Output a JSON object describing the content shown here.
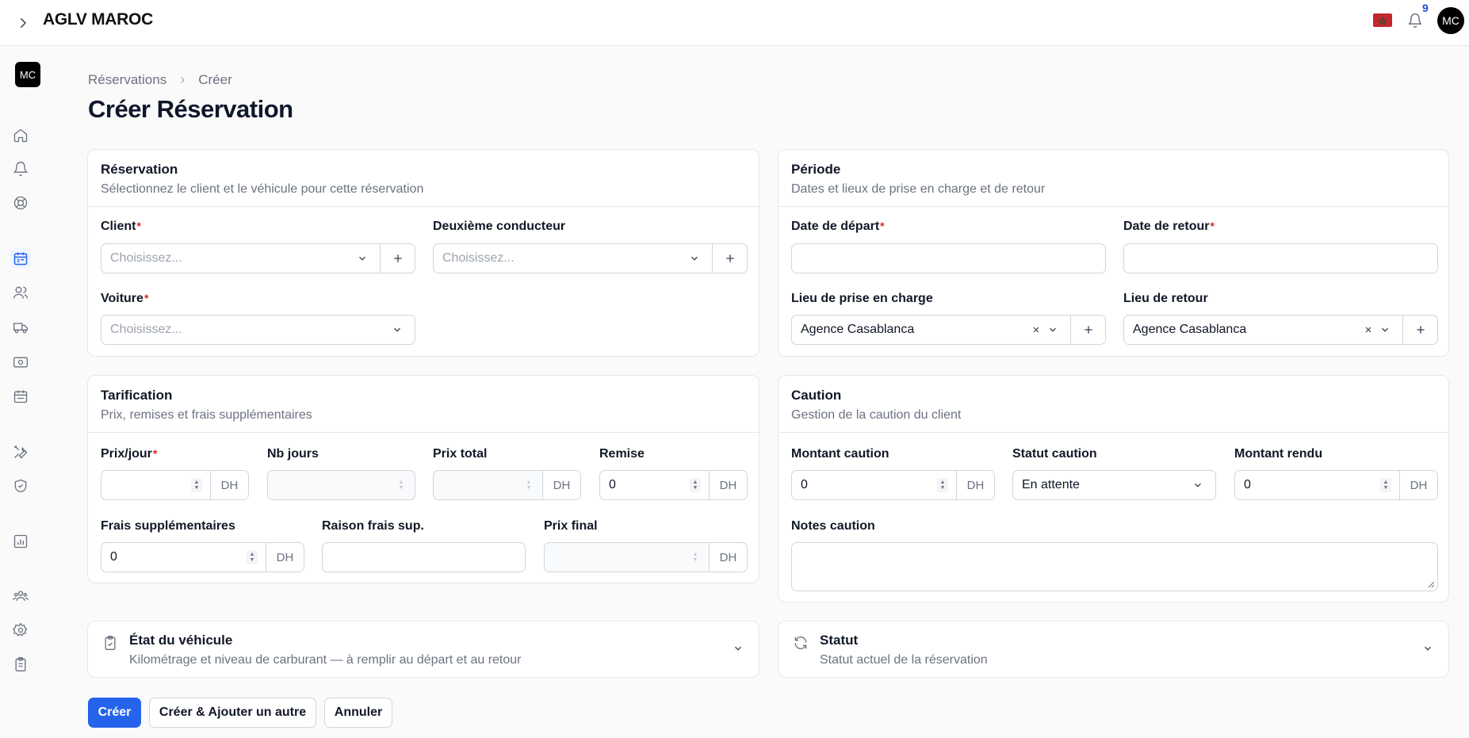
{
  "app": {
    "title": "AGLV MAROC",
    "user_initials": "MC",
    "notification_count": "9"
  },
  "breadcrumb": {
    "parent": "Réservations",
    "current": "Créer"
  },
  "page": {
    "title": "Créer Réservation"
  },
  "sections": {
    "reservation": {
      "title": "Réservation",
      "subtitle": "Sélectionnez le client et le véhicule pour cette réservation",
      "client_label": "Client",
      "client_placeholder": "Choisissez...",
      "second_driver_label": "Deuxième conducteur",
      "second_driver_placeholder": "Choisissez...",
      "car_label": "Voiture",
      "car_placeholder": "Choisissez..."
    },
    "periode": {
      "title": "Période",
      "subtitle": "Dates et lieux de prise en charge et de retour",
      "start_date_label": "Date de départ",
      "start_date_value": "",
      "return_date_label": "Date de retour",
      "return_date_value": "",
      "pickup_label": "Lieu de prise en charge",
      "pickup_value": "Agence Casablanca",
      "return_label": "Lieu de retour",
      "return_value": "Agence Casablanca"
    },
    "tarification": {
      "title": "Tarification",
      "subtitle": "Prix, remises et frais supplémentaires",
      "price_day_label": "Prix/jour",
      "price_day_value": "",
      "nb_days_label": "Nb jours",
      "nb_days_value": "",
      "total_label": "Prix total",
      "total_value": "",
      "discount_label": "Remise",
      "discount_value": "0",
      "extra_fees_label": "Frais supplémentaires",
      "extra_fees_value": "0",
      "extra_reason_label": "Raison frais sup.",
      "extra_reason_value": "",
      "final_label": "Prix final",
      "final_value": "",
      "currency": "DH"
    },
    "caution": {
      "title": "Caution",
      "subtitle": "Gestion de la caution du client",
      "amount_label": "Montant caution",
      "amount_value": "0",
      "status_label": "Statut caution",
      "status_value": "En attente",
      "returned_label": "Montant rendu",
      "returned_value": "0",
      "notes_label": "Notes caution",
      "notes_value": "",
      "currency": "DH"
    },
    "vehicle_state": {
      "title": "État du véhicule",
      "subtitle": "Kilométrage et niveau de carburant — à remplir au départ et au retour"
    },
    "statut": {
      "title": "Statut",
      "subtitle": "Statut actuel de la réservation"
    }
  },
  "actions": {
    "create": "Créer",
    "create_another": "Créer & Ajouter un autre",
    "cancel": "Annuler"
  },
  "sidebar_icons": [
    "home-icon",
    "bell-icon",
    "lifebuoy-icon",
    "calendar-icon",
    "users-icon",
    "truck-icon",
    "banknote-icon",
    "calendar-days-icon",
    "tools-icon",
    "shield-check-icon",
    "chart-icon",
    "team-icon",
    "settings-icon",
    "clipboard-icon"
  ],
  "colors": {
    "primary": "#2563eb",
    "required": "#dc2626",
    "flag": "#c1272d"
  }
}
